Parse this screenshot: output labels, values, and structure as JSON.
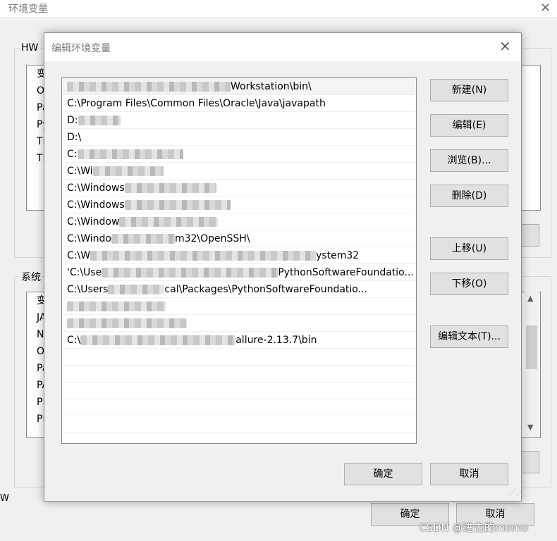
{
  "bg": {
    "title": "环境变量",
    "close_icon": "×",
    "user_group_label": "HW",
    "user_vars": [
      "变",
      "On",
      "Pa",
      "Py",
      "TE",
      "TM"
    ],
    "sys_group_label": "系统",
    "sys_vars": [
      "变",
      "JA",
      "NU",
      "OS",
      "Pa",
      "PA",
      "PR",
      "PR"
    ],
    "scroll_up": "▲",
    "scroll_down": "▼",
    "ok_label": "确定",
    "cancel_label": "取消",
    "left_edge": "W"
  },
  "dialog": {
    "title": "编辑环境变量",
    "close_icon": "×",
    "paths": [
      {
        "prefix": "",
        "suffix": "Workstation\\bin\\"
      },
      {
        "prefix": "",
        "suffix": "C:\\Program Files\\Common Files\\Oracle\\Java\\javapath"
      },
      {
        "prefix": "D:",
        "suffix": ""
      },
      {
        "prefix": "D:\\",
        "suffix": ""
      },
      {
        "prefix": "C:",
        "suffix": ""
      },
      {
        "prefix": "C:\\Wi",
        "suffix": ""
      },
      {
        "prefix": "C:\\Windows",
        "suffix": ""
      },
      {
        "prefix": "C:\\Windows",
        "suffix": ""
      },
      {
        "prefix": "C:\\Window",
        "suffix": ""
      },
      {
        "prefix": "C:\\Windo",
        "suffix": "m32\\OpenSSH\\"
      },
      {
        "prefix": "C:\\W",
        "suffix": "ystem32"
      },
      {
        "prefix": "'C:\\Use",
        "suffix": "PythonSoftwareFoundatio..."
      },
      {
        "prefix": "C:\\Users",
        "suffix": "cal\\Packages\\PythonSoftwareFoundatio..."
      },
      {
        "prefix": "",
        "suffix": ""
      },
      {
        "prefix": "",
        "suffix": ""
      },
      {
        "prefix": "C:\\",
        "suffix": "allure-2.13.7\\bin"
      }
    ],
    "buttons": {
      "new": "新建(N)",
      "edit": "编辑(E)",
      "browse": "浏览(B)...",
      "delete": "删除(D)",
      "up": "上移(U)",
      "down": "下移(O)",
      "edit_text": "编辑文本(T)...",
      "ok": "确定",
      "cancel": "取消"
    }
  },
  "watermark": "CSDN @进击的momo"
}
